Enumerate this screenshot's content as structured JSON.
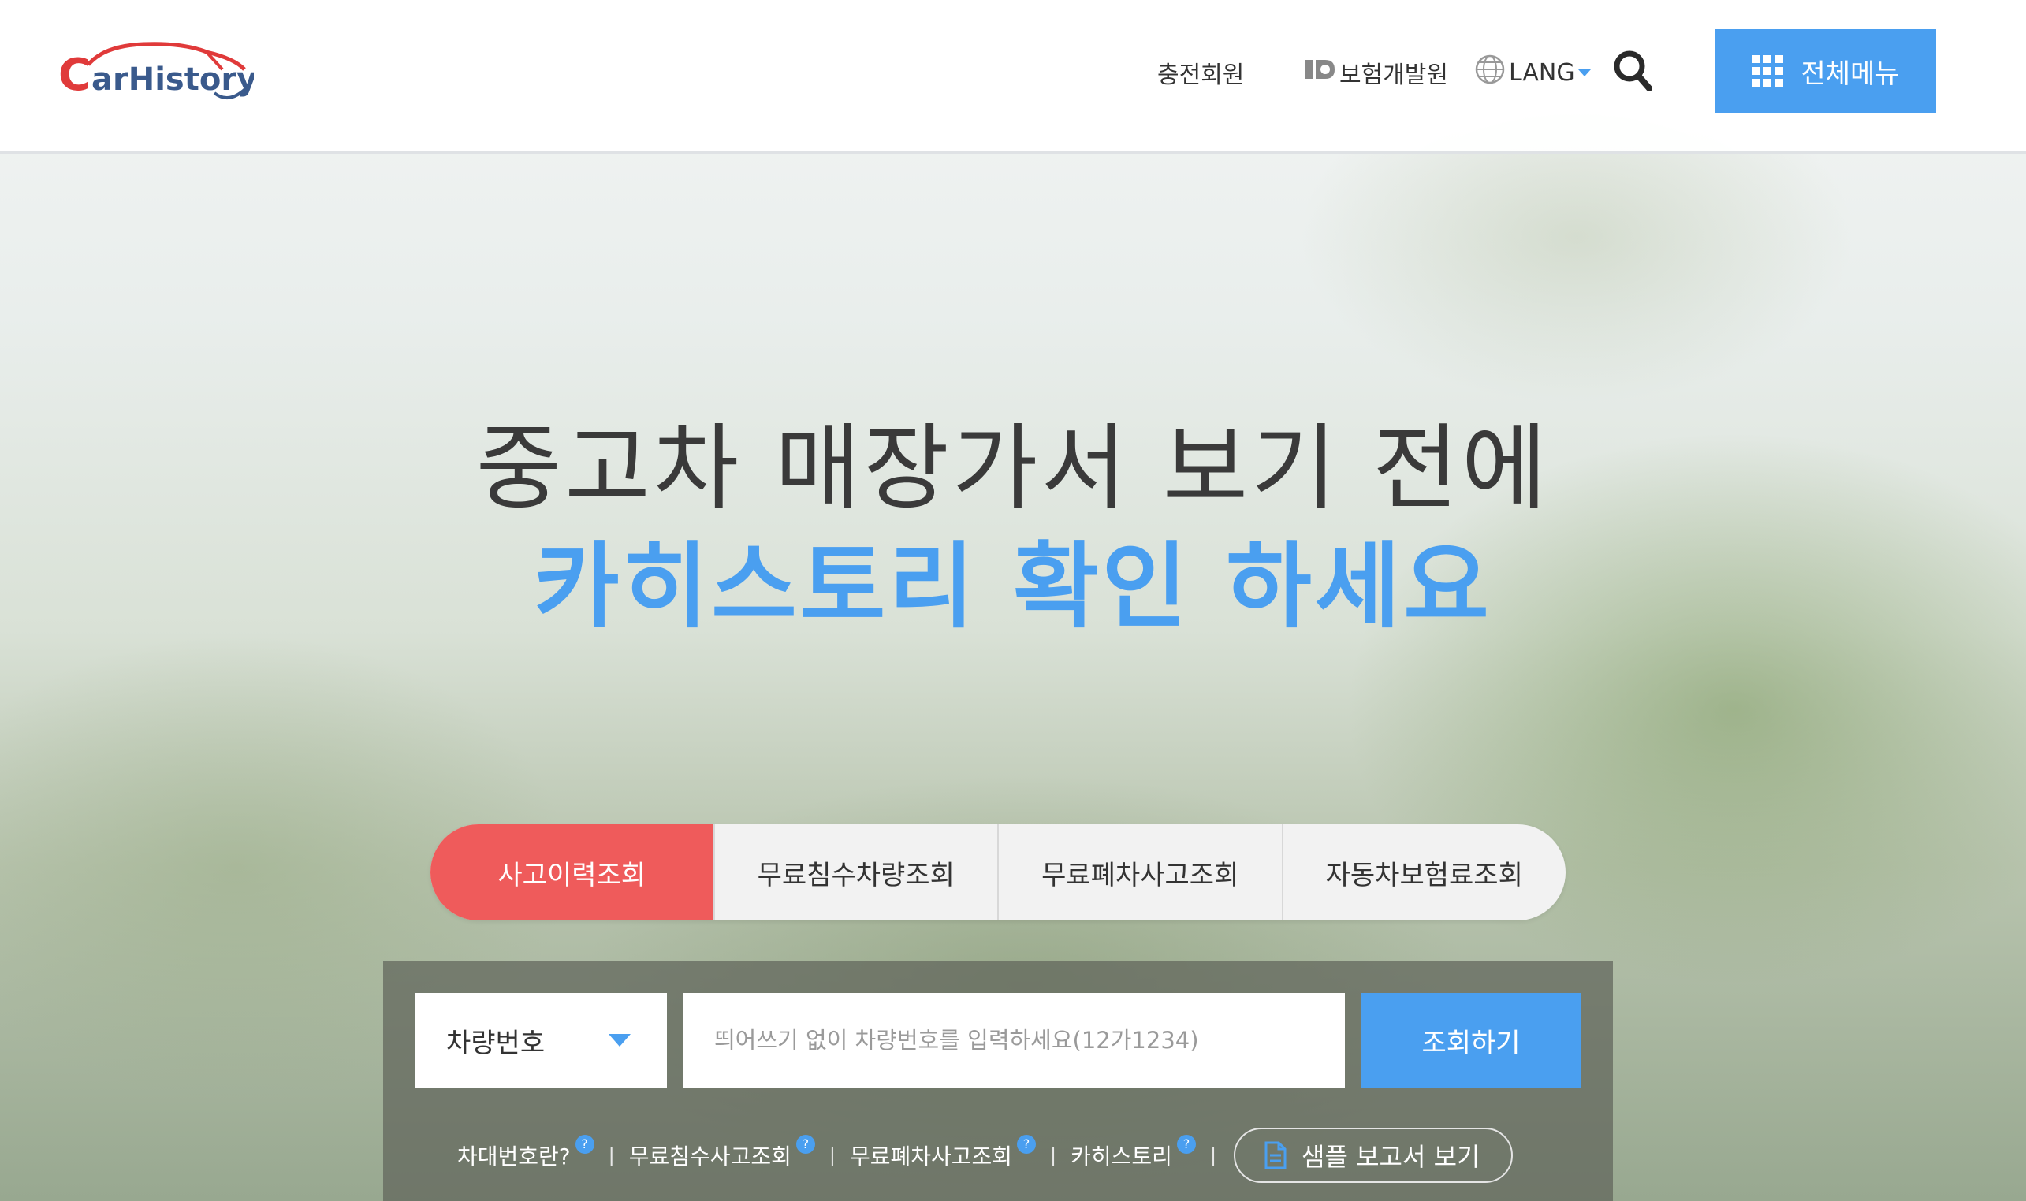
{
  "header": {
    "logo_text": "CarHistory",
    "nav": {
      "charge_member": "충전회원",
      "insurance_institute": "보험개발원",
      "lang": "LANG"
    },
    "menu_label": "전체메뉴"
  },
  "hero": {
    "line1": "중고차 매장가서 보기 전에",
    "line2": "카히스토리 확인 하세요"
  },
  "tabs": [
    {
      "label": "사고이력조회",
      "active": true
    },
    {
      "label": "무료침수차량조회",
      "active": false
    },
    {
      "label": "무료폐차사고조회",
      "active": false
    },
    {
      "label": "자동차보험료조회",
      "active": false
    }
  ],
  "search": {
    "select_value": "차량번호",
    "input_placeholder": "띄어쓰기 없이 차량번호를 입력하세요(12가1234)",
    "submit_label": "조회하기"
  },
  "links": [
    {
      "label": "차대번호란?",
      "help": "?"
    },
    {
      "label": "무료침수사고조회",
      "help": "?"
    },
    {
      "label": "무료폐차사고조회",
      "help": "?"
    },
    {
      "label": "카히스토리",
      "help": "?"
    }
  ],
  "separator": "|",
  "sample_report_label": "샘플 보고서 보기",
  "colors": {
    "accent_blue": "#4a9ff0",
    "active_tab_red": "#ef5b5b",
    "logo_red": "#e03a3a"
  },
  "icons": [
    "globe-icon",
    "search-icon",
    "grid-menu-icon",
    "caret-down-icon",
    "help-icon",
    "document-icon",
    "kidi-logo-icon"
  ]
}
